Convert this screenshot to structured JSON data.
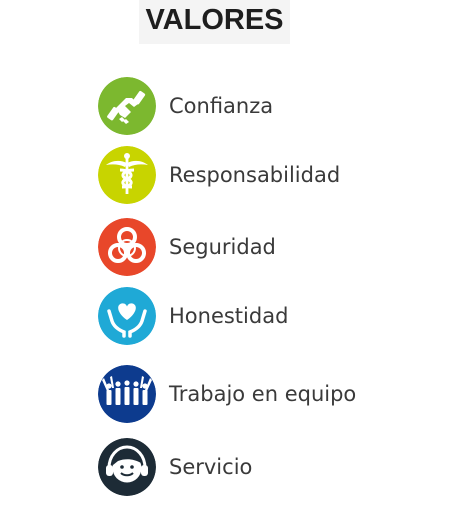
{
  "title": "VALORES",
  "values": [
    {
      "label": "Confianza",
      "icon": "handshake-icon",
      "color": "#7cb82f"
    },
    {
      "label": "Responsabilidad",
      "icon": "caduceus-icon",
      "color": "#c8d400"
    },
    {
      "label": "Seguridad",
      "icon": "biohazard-icon",
      "color": "#e8472a"
    },
    {
      "label": "Honestidad",
      "icon": "heart-hands-icon",
      "color": "#1fa9d6"
    },
    {
      "label": "Trabajo en equipo",
      "icon": "team-icon",
      "color": "#0d3b8e"
    },
    {
      "label": "Servicio",
      "icon": "headset-agent-icon",
      "color": "#1d2b36"
    }
  ]
}
